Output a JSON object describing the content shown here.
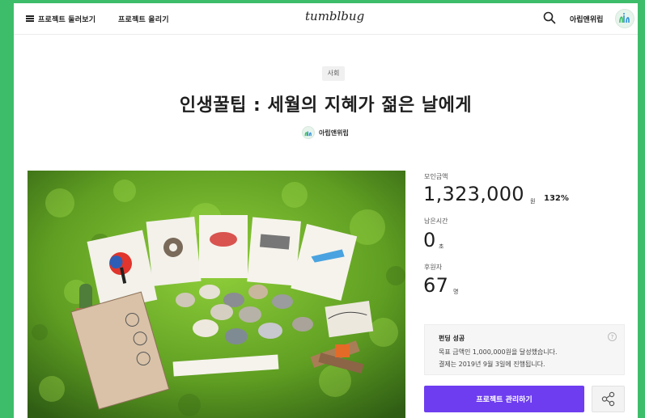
{
  "header": {
    "browse_label": "프로젝트 둘러보기",
    "upload_label": "프로젝트 올리기",
    "logo_text": "tumblbug",
    "user_name": "아립앤위립"
  },
  "project": {
    "category": "사회",
    "title": "인생꿀팁 : 세월의 지혜가 젊은 날에게",
    "creator": "아립앤위립"
  },
  "stats": {
    "raised_label": "모인금액",
    "raised_value": "1,323,000",
    "raised_unit": "원",
    "percent": "132%",
    "time_label": "남은시간",
    "time_value": "0",
    "time_unit": "초",
    "backers_label": "후원자",
    "backers_value": "67",
    "backers_unit": "명"
  },
  "funding": {
    "status": "펀딩 성공",
    "line1": "목표 금액인 1,000,000원을 달성했습니다.",
    "line2": "결제는 2019년 9월 3일에 진행됩니다.",
    "help": "?"
  },
  "actions": {
    "manage_label": "프로젝트 관리하기"
  },
  "colors": {
    "accent": "#6e3df0",
    "frame": "#3dbd6a"
  }
}
